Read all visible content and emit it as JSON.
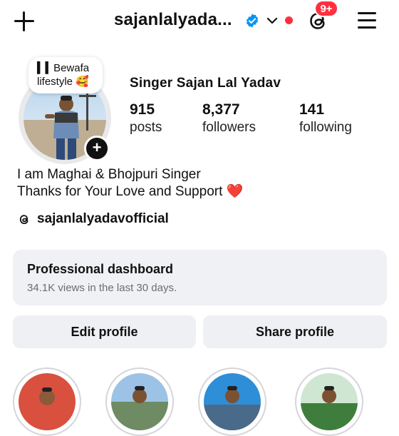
{
  "header": {
    "username": "sajanlalyada...",
    "notification_badge": "9+",
    "accent_color": "#0095f6",
    "alert_color": "#ff3040"
  },
  "profile": {
    "note_line1": "▍▍Bewafa",
    "note_line2": "lifestyle 🥰",
    "display_name": "Singer Sajan Lal Yadav",
    "stats": [
      {
        "value": "915",
        "label": "posts"
      },
      {
        "value": "8,377",
        "label": "followers"
      },
      {
        "value": "141",
        "label": "following"
      }
    ],
    "bio_line1": "I am Maghai & Bhojpuri Singer",
    "bio_line2": "Thanks for Your Love and Support ❤️",
    "threads_handle": "sajanlalyadavofficial"
  },
  "dashboard": {
    "title": "Professional dashboard",
    "subtitle": "34.1K views in the last 30 days."
  },
  "actions": {
    "edit_label": "Edit profile",
    "share_label": "Share profile"
  },
  "icons": {
    "top_left": "plus-icon",
    "verified": "verified-badge-icon",
    "dropdown": "chevron-down-icon",
    "threads": "threads-icon",
    "menu": "hamburger-menu-icon",
    "add_story": "plus-icon"
  }
}
